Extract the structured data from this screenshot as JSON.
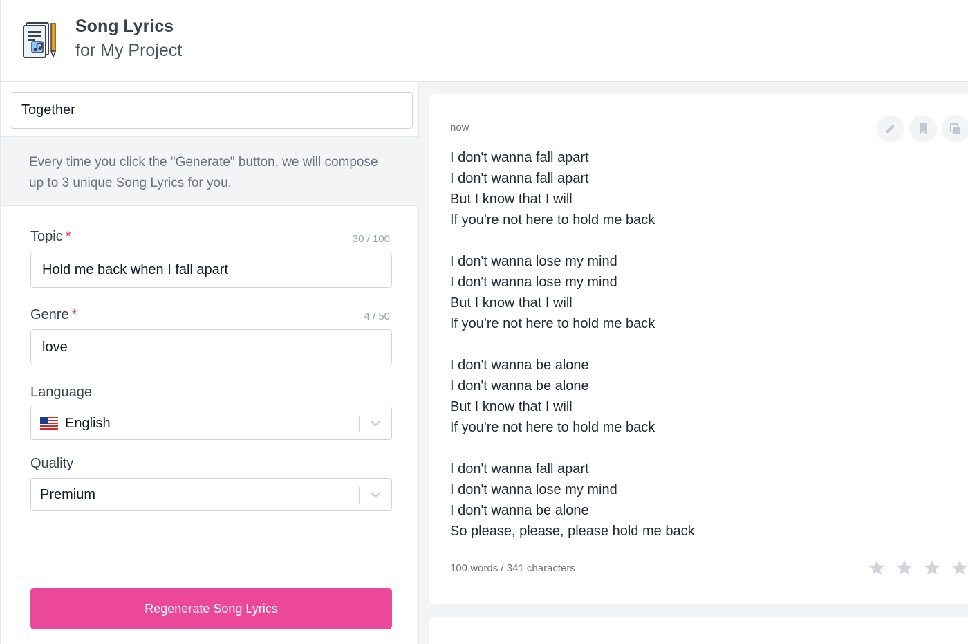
{
  "header": {
    "title": "Song Lyrics",
    "subtitle": "for My Project",
    "icon": "lyrics-document-icon"
  },
  "form": {
    "project_name_value": "Together",
    "info_text": "Every time you click the \"Generate\" button, we will compose up to 3 unique Song Lyrics for you.",
    "required_marker": "*",
    "topic": {
      "label": "Topic",
      "counter": "30 / 100",
      "value": "Hold me back when I fall apart"
    },
    "genre": {
      "label": "Genre",
      "counter": "4 / 50",
      "value": "love"
    },
    "language": {
      "label": "Language",
      "value": "English",
      "flag_icon": "us-flag-icon"
    },
    "quality": {
      "label": "Quality",
      "value": "Premium"
    },
    "submit_label": "Regenerate Song Lyrics"
  },
  "result": {
    "timestamp": "now",
    "stanzas": [
      [
        "I don't wanna fall apart",
        "I don't wanna fall apart",
        "But I know that I will",
        "If you're not here to hold me back"
      ],
      [
        "I don't wanna lose my mind",
        "I don't wanna lose my mind",
        "But I know that I will",
        "If you're not here to hold me back"
      ],
      [
        "I don't wanna be alone",
        "I don't wanna be alone",
        "But I know that I will",
        "If you're not here to hold me back"
      ],
      [
        "I don't wanna fall apart",
        "I don't wanna lose my mind",
        "I don't wanna be alone",
        "So please, please, please hold me back"
      ]
    ],
    "stats": "100 words / 341 characters",
    "rating": {
      "value": 0,
      "max": 5
    },
    "actions": [
      "edit-icon",
      "bookmark-icon",
      "copy-icon"
    ]
  },
  "colors": {
    "accent": "#ec4899",
    "required": "#ef4444",
    "background": "#f3f4f6"
  }
}
